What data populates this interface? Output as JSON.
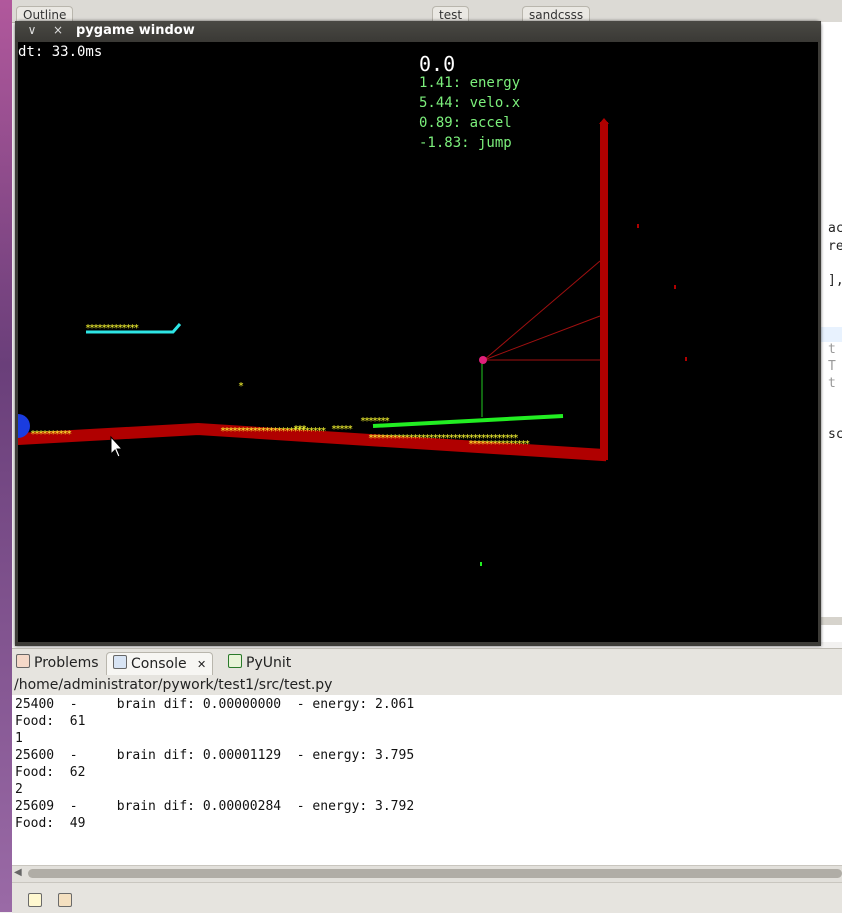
{
  "ide": {
    "top_tabs": [
      "Outline",
      "test",
      "sandcsss"
    ],
    "right_fragments": [
      "ac",
      "re",
      "],",
      "t",
      "T",
      "t",
      "sc"
    ]
  },
  "pygame": {
    "title": "pygame window",
    "close_glyph": "×",
    "menu_glyph": "∨",
    "dt_label": "dt: 33.0ms",
    "score": "0.0",
    "stats": [
      "1.41: energy",
      "5.44: velo.x",
      "0.89: accel",
      "-1.83: jump"
    ],
    "colors": {
      "background": "#000000",
      "terrain": "#b00000",
      "food": "#ffff33",
      "platform_cyan": "#2ee6e6",
      "platform_green": "#22ee22",
      "creature": "#e0207a",
      "player_ball": "#1a3ce0",
      "stats_text": "#7cf07c"
    }
  },
  "console_panel": {
    "tabs": [
      {
        "label": "Problems",
        "icon": "problems-icon"
      },
      {
        "label": "Console",
        "icon": "console-icon",
        "close": "✕"
      },
      {
        "label": "PyUnit",
        "icon": "pyunit-icon"
      }
    ],
    "path": "/home/administrator/pywork/test1/src/test.py",
    "lines": [
      "25400  -     brain dif: 0.00000000  - energy: 2.061",
      "Food:  61",
      "1",
      "25600  -     brain dif: 0.00001129  - energy: 3.795",
      "Food:  62",
      "2",
      "25609  -     brain dif: 0.00000284  - energy: 3.792",
      "Food:  49"
    ]
  }
}
